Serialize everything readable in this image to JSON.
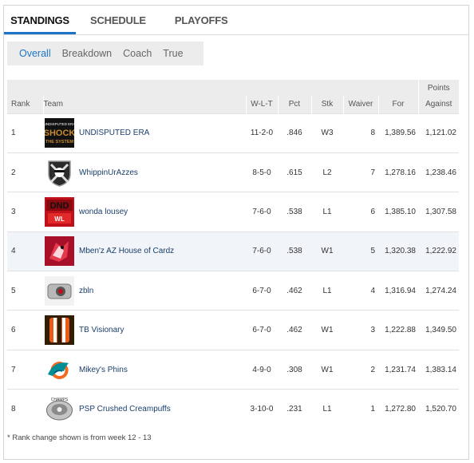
{
  "tabs": [
    "STANDINGS",
    "SCHEDULE",
    "PLAYOFFS"
  ],
  "subnav": [
    "Overall",
    "Breakdown",
    "Coach",
    "True"
  ],
  "columns": {
    "points_group": "Points",
    "rank": "Rank",
    "team": "Team",
    "wlt": "W-L-T",
    "pct": "Pct",
    "stk": "Stk",
    "waiver": "Waiver",
    "for": "For",
    "against": "Against"
  },
  "rows": [
    {
      "rank": "1",
      "team": "UNDISPUTED ERA",
      "logo": "shock-the-system-logo",
      "wlt": "11-2-0",
      "pct": ".846",
      "stk": "W3",
      "waiver": "8",
      "for": "1,389.56",
      "against": "1,121.02"
    },
    {
      "rank": "2",
      "team": "WhippinUrAzzes",
      "logo": "raiders-logo",
      "wlt": "8-5-0",
      "pct": ".615",
      "stk": "L2",
      "waiver": "7",
      "for": "1,278.16",
      "against": "1,238.46"
    },
    {
      "rank": "3",
      "team": "wonda lousey",
      "logo": "red-dnd-logo",
      "wlt": "7-6-0",
      "pct": ".538",
      "stk": "L1",
      "waiver": "6",
      "for": "1,385.10",
      "against": "1,307.58"
    },
    {
      "rank": "4",
      "team": "Mben'z AZ House of Cardz",
      "logo": "cardinals-logo",
      "wlt": "7-6-0",
      "pct": ".538",
      "stk": "W1",
      "waiver": "5",
      "for": "1,320.38",
      "against": "1,222.92"
    },
    {
      "rank": "5",
      "team": "zbln",
      "logo": "ring-logo",
      "wlt": "6-7-0",
      "pct": ".462",
      "stk": "L1",
      "waiver": "4",
      "for": "1,316.94",
      "against": "1,274.24"
    },
    {
      "rank": "6",
      "team": "TB Visionary",
      "logo": "browns-stripes-logo",
      "wlt": "6-7-0",
      "pct": ".462",
      "stk": "W1",
      "waiver": "3",
      "for": "1,222.88",
      "against": "1,349.50"
    },
    {
      "rank": "7",
      "team": "Mikey's Phins",
      "logo": "dolphins-logo",
      "wlt": "4-9-0",
      "pct": ".308",
      "stk": "W1",
      "waiver": "2",
      "for": "1,231.74",
      "against": "1,383.14"
    },
    {
      "rank": "8",
      "team": "PSP Crushed Creampuffs",
      "logo": "championship-ring-logo",
      "wlt": "3-10-0",
      "pct": ".231",
      "stk": "L1",
      "waiver": "1",
      "for": "1,272.80",
      "against": "1,520.70"
    }
  ],
  "footnote": "* Rank change shown is from week 12 - 13"
}
